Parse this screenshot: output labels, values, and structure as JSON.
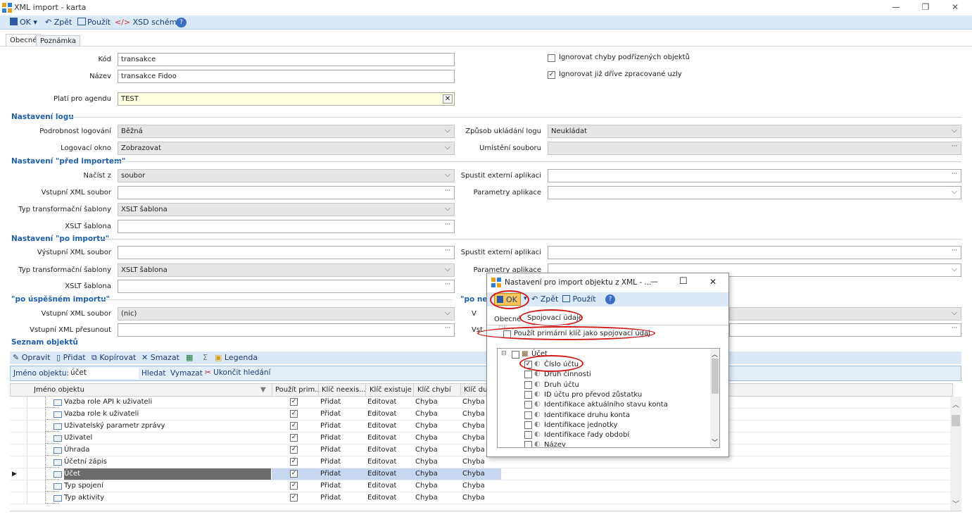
{
  "window": {
    "title": "XML import - karta",
    "minimize": "—",
    "maximize": "❐",
    "close": "✕"
  },
  "toolbar": {
    "ok": "OK",
    "back": "Zpět",
    "apply": "Použít",
    "xsd": "XSD schéma",
    "help": "?"
  },
  "tabs": [
    "Obecné",
    "Poznámka"
  ],
  "general": {
    "kod_label": "Kód",
    "kod_value": "transakce",
    "nazev_label": "Název",
    "nazev_value": "transakce Fidoo",
    "agenda_label": "Platí pro agendu",
    "agenda_value": "TEST",
    "ignore_errors_label": "Ignorovat chyby podřízených objektů",
    "ignore_errors_checked": false,
    "ignore_processed_label": "Ignorovat již dříve zpracované uzly",
    "ignore_processed_checked": true
  },
  "log": {
    "section": "Nastavení logu",
    "detail_label": "Podrobnost logování",
    "detail_value": "Běžná",
    "window_label": "Logovací okno",
    "window_value": "Zobrazovat",
    "save_mode_label": "Způsob ukládání logu",
    "save_mode_value": "Neukládat",
    "file_location_label": "Umístění souboru",
    "file_location_value": ""
  },
  "before": {
    "section": "Nastavení \"před importem\"",
    "load_from_label": "Načíst z",
    "load_from_value": "soubor",
    "input_xml_label": "Vstupní XML soubor",
    "input_xml_value": "",
    "transform_label": "Typ transformační šablony",
    "transform_value": "XSLT šablona",
    "xslt_label": "XSLT šablona",
    "xslt_value": "",
    "ext_app_label": "Spustit externí aplikaci",
    "ext_app_value": "",
    "app_params_label": "Parametry aplikace",
    "app_params_value": ""
  },
  "after": {
    "section": "Nastavení \"po importu\"",
    "output_xml_label": "Výstupní XML soubor",
    "output_xml_value": "",
    "transform_label": "Typ transformační šablony",
    "transform_value": "XSLT šablona",
    "xslt_label": "XSLT šablona",
    "xslt_value": "",
    "ext_app_label": "Spustit externí aplikaci",
    "ext_app_value": "",
    "app_params_label": "Parametry aplikace",
    "app_params_value": ""
  },
  "success": {
    "section": "\"po úspěšném importu\"",
    "input_xml_label": "Vstupní XML soubor",
    "input_xml_value": "(nic)",
    "move_label": "Vstupní XML přesunout",
    "move_value": "",
    "right_section": "\"po neu",
    "right_label1": "V",
    "right_label2": "Vst"
  },
  "objects": {
    "section": "Seznam objektů",
    "toolbar": {
      "edit": "Opravit",
      "add": "Přidat",
      "copy": "Kopírovat",
      "delete": "Smazat",
      "sum": "Σ",
      "legend": "Legenda"
    },
    "search_label": "Jméno objektu:",
    "search_value": "účet",
    "find": "Hledat",
    "clear": "Vymazat",
    "end_search": "Ukončit hledání",
    "columns": [
      "Jméno objektu",
      "Použít prim...",
      "Klíč neexis...",
      "Klíč existuje",
      "Klíč chybí",
      "Klíč dup"
    ],
    "rows": [
      {
        "name": "Vazba role API k uživateli",
        "use": true,
        "nex": "Přidat",
        "ex": "Editovat",
        "miss": "Chyba",
        "dup": "Chyba"
      },
      {
        "name": "Vazba role k uživateli",
        "use": true,
        "nex": "Přidat",
        "ex": "Editovat",
        "miss": "Chyba",
        "dup": "Chyba"
      },
      {
        "name": "Uživatelský parametr zprávy",
        "use": true,
        "nex": "Přidat",
        "ex": "Editovat",
        "miss": "Chyba",
        "dup": "Chyba"
      },
      {
        "name": "Uživatel",
        "use": true,
        "nex": "Přidat",
        "ex": "Editovat",
        "miss": "Chyba",
        "dup": "Chyba"
      },
      {
        "name": "Úhrada",
        "use": true,
        "nex": "Přidat",
        "ex": "Editovat",
        "miss": "Chyba",
        "dup": "Chyba"
      },
      {
        "name": "Účetní zápis",
        "use": true,
        "nex": "Přidat",
        "ex": "Editovat",
        "miss": "Chyba",
        "dup": "Chyba"
      },
      {
        "name": "Účet",
        "use": true,
        "nex": "Přidat",
        "ex": "Editovat",
        "miss": "Chyba",
        "dup": "Chyba"
      },
      {
        "name": "Typ spojení",
        "use": true,
        "nex": "Přidat",
        "ex": "Editovat",
        "miss": "Chyba",
        "dup": "Chyba"
      },
      {
        "name": "Typ aktivity",
        "use": true,
        "nex": "Přidat",
        "ex": "Editovat",
        "miss": "Chyba",
        "dup": "Chyba"
      }
    ]
  },
  "dialog": {
    "title": "Nastavení pro import objektu z XML - ...",
    "minimize": "—",
    "maximize": "☐",
    "close": "✕",
    "ok": "OK",
    "back": "Zpět",
    "apply": "Použít",
    "help": "?",
    "tabs": [
      "Obecné",
      "Spojovací údaje"
    ],
    "use_primary_key_label": "Použít primární klíč jako spojovací údaj",
    "ok_ghost": "OK",
    "tree_root": "Účet",
    "tree_items": [
      {
        "label": "Číslo účtu",
        "checked": true
      },
      {
        "label": "Druh činnosti",
        "checked": false
      },
      {
        "label": "Druh účtu",
        "checked": false
      },
      {
        "label": "ID účtu pro převod zůstatku",
        "checked": false
      },
      {
        "label": "Identifikace aktuálního stavu konta",
        "checked": false
      },
      {
        "label": "Identifikace druhu konta",
        "checked": false
      },
      {
        "label": "Identifikace jednotky",
        "checked": false
      },
      {
        "label": "Identifikace řady období",
        "checked": false
      },
      {
        "label": "Název",
        "checked": false
      }
    ]
  },
  "colors": {
    "accent": "#1f5ea8",
    "toolbar": "#dbe9f7",
    "highlight": "#d11a1a",
    "selected_row": "#6b6b6b"
  }
}
